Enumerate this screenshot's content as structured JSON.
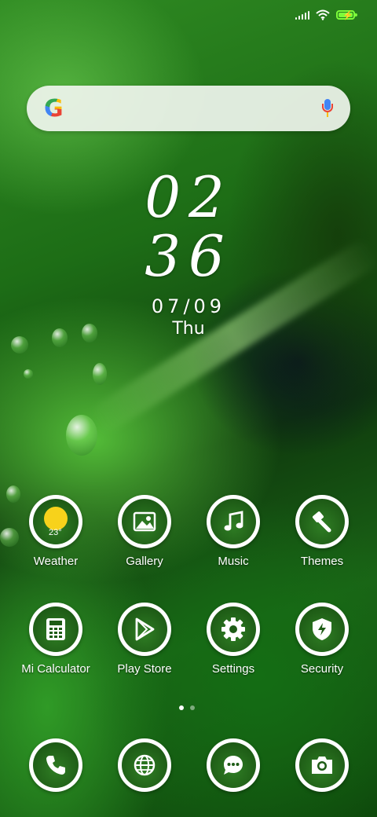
{
  "status_bar": {
    "signal_icon": "signal-bars-icon",
    "wifi_icon": "wifi-icon",
    "battery_icon": "battery-charging-icon",
    "battery_color": "#7CFC3A"
  },
  "search": {
    "logo_text": "G",
    "mic_icon": "microphone-icon"
  },
  "clock": {
    "hour": "02",
    "minute": "36",
    "date": "07/09",
    "day": "Thu"
  },
  "apps": {
    "weather": {
      "label": "Weather",
      "temp": "23°",
      "icon": "weather-sun-icon"
    },
    "gallery": {
      "label": "Gallery",
      "icon": "gallery-icon"
    },
    "music": {
      "label": "Music",
      "icon": "music-note-icon"
    },
    "themes": {
      "label": "Themes",
      "icon": "paintbrush-icon"
    },
    "calculator": {
      "label": "Mi Calculator",
      "icon": "calculator-icon"
    },
    "play_store": {
      "label": "Play Store",
      "icon": "play-store-icon"
    },
    "settings": {
      "label": "Settings",
      "icon": "gear-icon"
    },
    "security": {
      "label": "Security",
      "icon": "shield-icon"
    }
  },
  "dock": {
    "phone": {
      "icon": "phone-icon"
    },
    "browser": {
      "icon": "globe-icon"
    },
    "messages": {
      "icon": "chat-bubble-icon"
    },
    "camera": {
      "icon": "camera-icon"
    }
  },
  "page_indicator": {
    "pages": 2,
    "current": 1
  }
}
